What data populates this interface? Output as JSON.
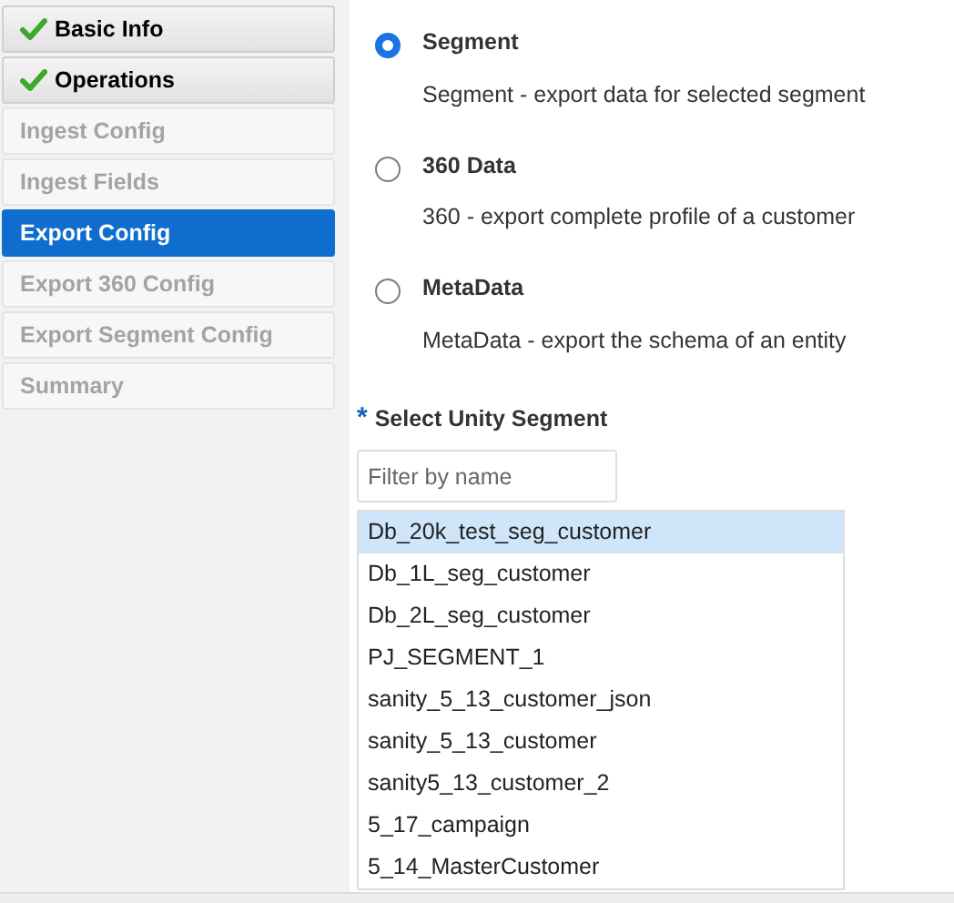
{
  "steps": [
    {
      "label": "Basic Info",
      "completed": true,
      "disabled": false,
      "selected": false
    },
    {
      "label": "Operations",
      "completed": true,
      "disabled": false,
      "selected": false
    },
    {
      "label": "Ingest Config",
      "completed": false,
      "disabled": true,
      "selected": false
    },
    {
      "label": "Ingest Fields",
      "completed": false,
      "disabled": true,
      "selected": false
    },
    {
      "label": "Export Config",
      "completed": false,
      "disabled": false,
      "selected": true
    },
    {
      "label": "Export 360 Config",
      "completed": false,
      "disabled": true,
      "selected": false
    },
    {
      "label": "Export Segment Config",
      "completed": false,
      "disabled": true,
      "selected": false
    },
    {
      "label": "Summary",
      "completed": false,
      "disabled": true,
      "selected": false
    }
  ],
  "export_types": [
    {
      "label": "Segment",
      "description": "Segment - export data for selected segment",
      "selected": true
    },
    {
      "label": "360 Data",
      "description": "360 - export complete profile of a customer",
      "selected": false
    },
    {
      "label": "MetaData",
      "description": "MetaData - export the schema of an entity",
      "selected": false
    }
  ],
  "segment_field": {
    "label": "Select Unity Segment",
    "required_mark": "*",
    "filter_placeholder": "Filter by name",
    "options": [
      {
        "label": "Db_20k_test_seg_customer",
        "selected": true
      },
      {
        "label": "Db_1L_seg_customer",
        "selected": false
      },
      {
        "label": "Db_2L_seg_customer",
        "selected": false
      },
      {
        "label": "PJ_SEGMENT_1",
        "selected": false
      },
      {
        "label": "sanity_5_13_customer_json",
        "selected": false
      },
      {
        "label": "sanity_5_13_customer",
        "selected": false
      },
      {
        "label": "sanity5_13_customer_2",
        "selected": false
      },
      {
        "label": "5_17_campaign",
        "selected": false
      },
      {
        "label": "5_14_MasterCustomer",
        "selected": false
      }
    ]
  }
}
